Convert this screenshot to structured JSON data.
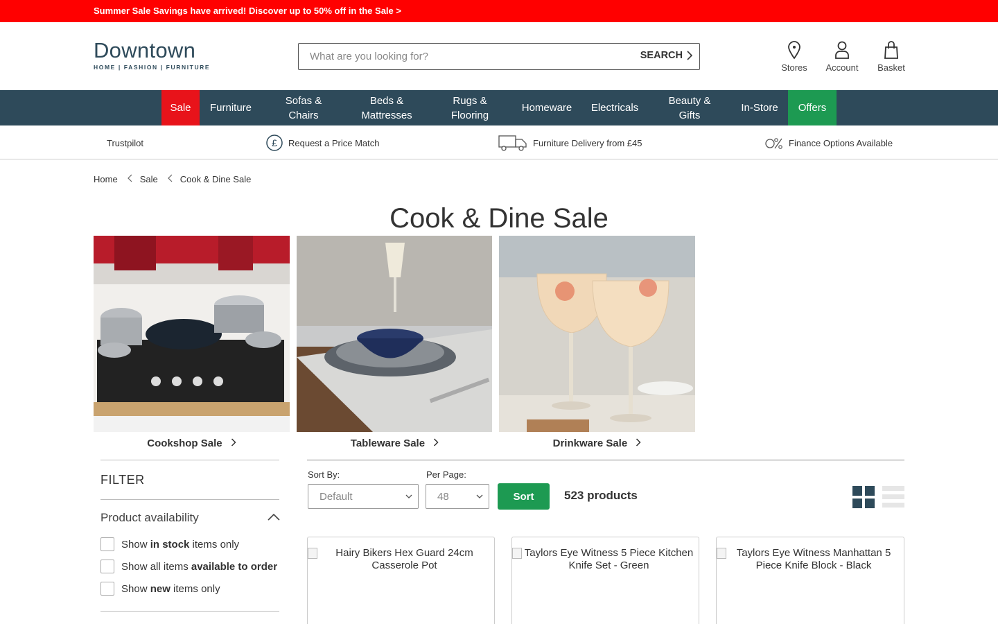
{
  "promo": {
    "text": "Summer Sale Savings have arrived! Discover up to 50% off in the Sale >"
  },
  "header": {
    "logo_main": "Downtown",
    "logo_sub": "HOME | FASHION | FURNITURE",
    "search_placeholder": "What are you looking for?",
    "search_button": "SEARCH",
    "icons": [
      {
        "label": "Stores",
        "icon": "map-pin-icon"
      },
      {
        "label": "Account",
        "icon": "user-icon"
      },
      {
        "label": "Basket",
        "icon": "shopping-bag-icon"
      }
    ]
  },
  "nav": {
    "items": [
      {
        "label": "Sale"
      },
      {
        "label": "Furniture"
      },
      {
        "label": "Sofas & Chairs"
      },
      {
        "label": "Beds & Mattresses"
      },
      {
        "label": "Rugs & Flooring"
      },
      {
        "label": "Homeware"
      },
      {
        "label": "Electricals"
      },
      {
        "label": "Beauty & Gifts"
      },
      {
        "label": "In-Store"
      },
      {
        "label": "Offers"
      }
    ]
  },
  "usp": {
    "items": [
      {
        "label": "Trustpilot"
      },
      {
        "label": "Request a Price Match",
        "icon": "pound-icon"
      },
      {
        "label": "Furniture Delivery from £45",
        "icon": "truck-icon"
      },
      {
        "label": "Finance Options Available",
        "icon": "zero-percent-icon"
      }
    ]
  },
  "breadcrumb": {
    "items": [
      "Home",
      "Sale",
      "Cook & Dine Sale"
    ]
  },
  "page": {
    "title": "Cook & Dine Sale"
  },
  "categories": [
    {
      "label": "Cookshop Sale"
    },
    {
      "label": "Tableware Sale"
    },
    {
      "label": "Drinkware Sale"
    }
  ],
  "filter": {
    "title": "FILTER",
    "availability_title": "Product availability",
    "options": [
      {
        "prefix": "Show ",
        "bold": "in stock",
        "suffix": " items only"
      },
      {
        "prefix": "Show all items ",
        "bold": "available to order",
        "suffix": ""
      },
      {
        "prefix": "Show ",
        "bold": "new",
        "suffix": " items only"
      }
    ]
  },
  "toolbar": {
    "sort_by_label": "Sort By:",
    "sort_by_value": "Default",
    "per_page_label": "Per Page:",
    "per_page_value": "48",
    "sort_button": "Sort",
    "count": "523 products"
  },
  "products": [
    {
      "name": "Hairy Bikers Hex Guard 24cm Casserole Pot"
    },
    {
      "name": "Taylors Eye Witness 5 Piece Kitchen Knife Set - Green"
    },
    {
      "name": "Taylors Eye Witness Manhattan 5 Piece Knife Block - Black"
    }
  ],
  "colors": {
    "promo_red": "#ff0000",
    "nav_bg": "#2e4a5a",
    "sale_red": "#e8131a",
    "offers_green": "#1d9a52"
  }
}
